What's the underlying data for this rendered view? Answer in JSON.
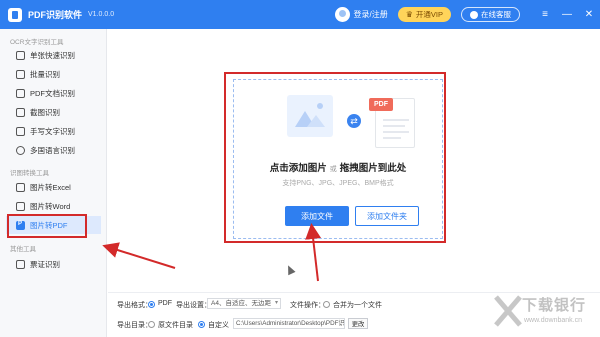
{
  "app": {
    "name": "PDF识别软件",
    "version": "V1.0.0.0",
    "login_label": "登录/注册",
    "vip_label": "开通VIP",
    "service_label": "在线客服",
    "brand_color": "#2f7ff0"
  },
  "window_controls": {
    "menu": "≡",
    "minimize": "—",
    "close": "✕"
  },
  "sidebar": {
    "sections": [
      {
        "title": "OCR文字识别工具",
        "items": [
          {
            "label": "单张快速识别",
            "icon": "image-scan-icon"
          },
          {
            "label": "批量识别",
            "icon": "batch-icon"
          },
          {
            "label": "PDF文档识别",
            "icon": "pdf-doc-icon"
          },
          {
            "label": "截图识别",
            "icon": "screenshot-icon"
          },
          {
            "label": "手写文字识别",
            "icon": "pen-icon"
          },
          {
            "label": "多国语言识别",
            "icon": "globe-icon"
          }
        ]
      },
      {
        "title": "识图转换工具",
        "items": [
          {
            "label": "图片转Excel",
            "icon": "excel-icon"
          },
          {
            "label": "图片转Word",
            "icon": "word-icon"
          },
          {
            "label": "图片转PDF",
            "icon": "pdf-icon",
            "active": true
          }
        ]
      },
      {
        "title": "其他工具",
        "items": [
          {
            "label": "票证识别",
            "icon": "ticket-icon"
          }
        ]
      }
    ]
  },
  "dropzone": {
    "pdf_tag": "PDF",
    "title_add": "点击添加图片",
    "title_or": "或",
    "title_drag": "拖拽图片到此处",
    "hint": "支持PNG、JPG、JPEG、BMP格式",
    "add_image_button": "添加文件",
    "add_folder_button": "添加文件夹"
  },
  "settings": {
    "export_format_label": "导出格式：",
    "export_format_value": "PDF",
    "export_setting_label": "导出设置：",
    "export_setting_value": "A4、自适应、无边距",
    "file_op_label": "文件操作：",
    "merge_label": "合并为一个文件",
    "export_dir_label": "导出目录：",
    "dir_source": "原文件目录",
    "dir_custom": "自定义",
    "path_value": "C:\\Users\\Administrator\\Desktop\\PDF识别软",
    "change_button": "更改"
  },
  "watermark": {
    "text": "下载银行",
    "url": "www.downbank.cn"
  }
}
